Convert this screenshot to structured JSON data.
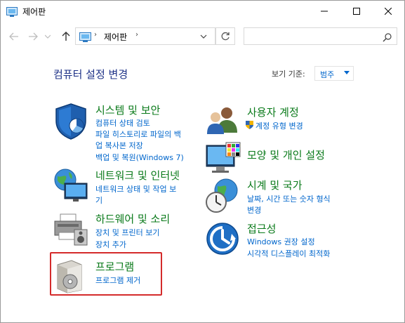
{
  "window": {
    "title": "제어판"
  },
  "address": {
    "location": "제어판"
  },
  "search": {
    "placeholder": ""
  },
  "header": {
    "heading": "컴퓨터 설정 변경",
    "view_by_label": "보기 기준:",
    "view_by_value": "범주"
  },
  "categories_left": [
    {
      "title": "시스템 및 보안",
      "links": [
        "컴퓨터 상태 검토",
        "파일 히스토리로 파일의 백",
        "업 복사본 저장",
        "백업 및 복원(Windows 7)"
      ]
    },
    {
      "title": "네트워크 및 인터넷",
      "links": [
        "네트워크 상태 및 작업 보",
        "기"
      ]
    },
    {
      "title": "하드웨어 및 소리",
      "links": [
        "장치 및 프린터 보기",
        "장치 추가"
      ]
    },
    {
      "title": "프로그램",
      "links": [
        "프로그램 제거"
      ]
    }
  ],
  "categories_right": [
    {
      "title": "사용자 계정",
      "links": [
        "계정 유형 변경"
      ]
    },
    {
      "title": "모양 및 개인 설정",
      "links": []
    },
    {
      "title": "시계 및 국가",
      "links": [
        "날짜, 시간 또는 숫자 형식",
        "변경"
      ]
    },
    {
      "title": "접근성",
      "links": [
        "Windows 권장 설정",
        "시각적 디스플레이 최적화"
      ]
    }
  ],
  "colors": {
    "accent": "#0066cc",
    "category_title": "#0a7a1a",
    "highlight": "#d42b2b"
  }
}
